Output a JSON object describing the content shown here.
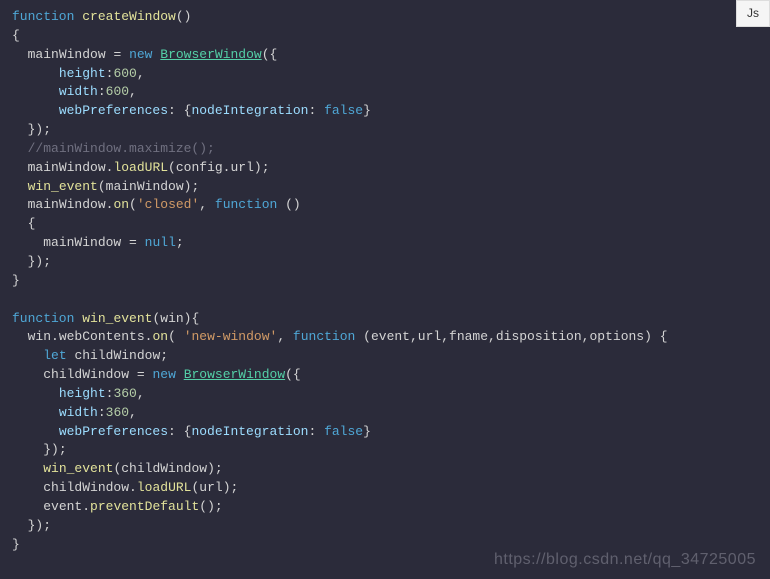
{
  "lang_badge": "Js",
  "watermark": "https://blog.csdn.net/qq_34725005",
  "code": {
    "kw_function": "function",
    "kw_new": "new",
    "kw_let": "let",
    "kw_false": "false",
    "kw_null": "null",
    "fn_createWindow": "createWindow",
    "fn_win_event": "win_event",
    "cls_BrowserWindow": "BrowserWindow",
    "id_mainWindow": "mainWindow",
    "id_childWindow": "childWindow",
    "id_win": "win",
    "id_config": "config",
    "id_url": "url",
    "id_event": "event",
    "id_fname": "fname",
    "id_disposition": "disposition",
    "id_options": "options",
    "prop_height": "height",
    "prop_width": "width",
    "prop_webPreferences": "webPreferences",
    "prop_nodeIntegration": "nodeIntegration",
    "prop_webContents": "webContents",
    "call_loadURL": "loadURL",
    "call_on": "on",
    "call_maximize": "maximize",
    "call_preventDefault": "preventDefault",
    "num_600": "600",
    "num_360": "360",
    "str_closed": "'closed'",
    "str_new_window": "'new-window'",
    "cmt_maximize": "//mainWindow.maximize();"
  }
}
